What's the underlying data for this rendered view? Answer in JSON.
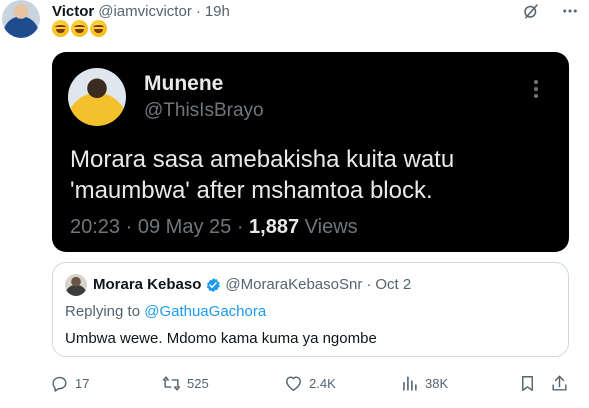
{
  "tweet": {
    "author_name": "Victor",
    "author_handle": "@iamvicvictor",
    "separator": "·",
    "time": "19h",
    "emoji_icons": [
      "rofl-emoji",
      "rofl-emoji",
      "rofl-emoji"
    ]
  },
  "media": {
    "name": "Munene",
    "handle": "@ThisIsBrayo",
    "text": "Morara sasa amebakisha kuita watu 'maumbwa' after mshamtoa block.",
    "time": "20:23",
    "separator": "·",
    "date": "09 May 25",
    "views_count": "1,887",
    "views_label": "Views"
  },
  "quote": {
    "name": "Morara Kebaso",
    "handle": "@MoraraKebasoSnr",
    "separator": "·",
    "date": "Oct 2",
    "replying_prefix": "Replying to",
    "replying_to": "@GathuaGachora",
    "text": "Umbwa wewe. Mdomo kama kuma ya ngombe"
  },
  "actions": {
    "replies": "17",
    "reposts": "525",
    "likes": "2.4K",
    "views": "38K"
  },
  "colors": {
    "text_primary": "#0f1419",
    "text_secondary": "#536471",
    "link": "#1d9bf0",
    "verified": "#1d9bf0",
    "media_background": "#000000"
  }
}
